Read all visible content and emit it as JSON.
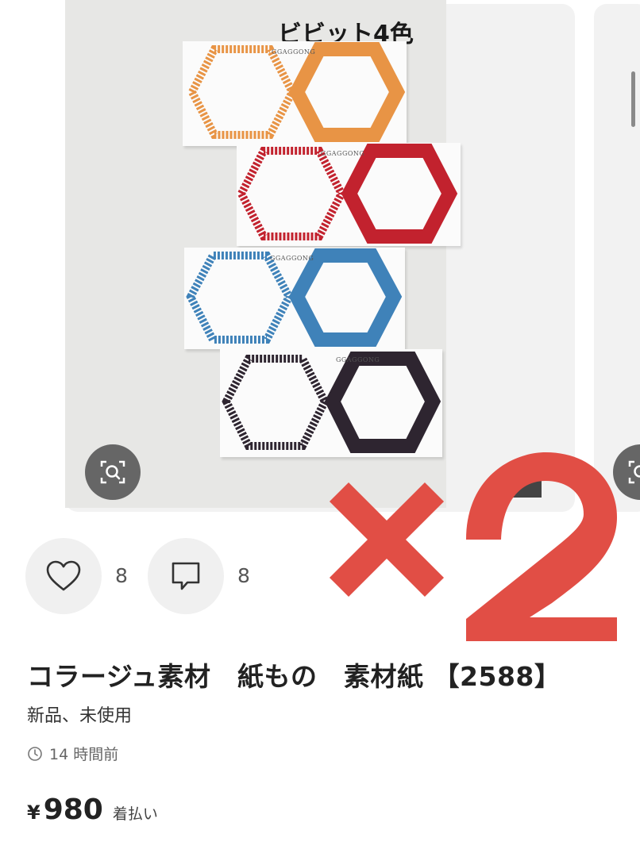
{
  "image": {
    "caption": "ビビット4色",
    "brand_text": "GGAGGONG",
    "card_colors": [
      "#e89445",
      "#c2222e",
      "#3f82b9",
      "#2e2530"
    ],
    "overlay_text": "×2",
    "overlay_color": "#e14e45"
  },
  "actions": {
    "like_icon": "heart-icon",
    "like_count": "8",
    "comment_icon": "comment-icon",
    "comment_count": "8"
  },
  "item": {
    "title": "コラージュ素材　紙もの　素材紙 【2588】",
    "condition": "新品、未使用",
    "time_icon": "clock-icon",
    "posted": "14 時間前",
    "price_symbol": "¥",
    "price": "980",
    "shipping": "着払い"
  }
}
